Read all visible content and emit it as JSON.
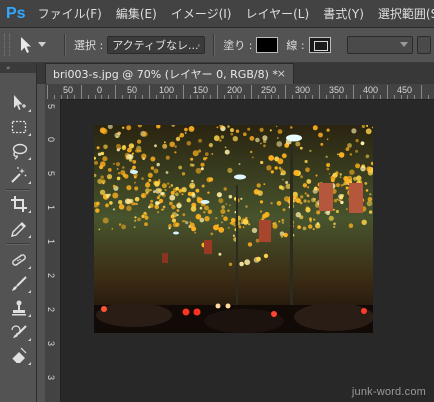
{
  "app": {
    "logo": "Ps"
  },
  "menu": [
    {
      "label": "ファイル(F)"
    },
    {
      "label": "編集(E)"
    },
    {
      "label": "イメージ(I)"
    },
    {
      "label": "レイヤー(L)"
    },
    {
      "label": "書式(Y)"
    },
    {
      "label": "選択範囲(S)"
    }
  ],
  "options": {
    "select_label": "選択 :",
    "select_value": "アクティブなレ...",
    "fill_label": "塗り :",
    "stroke_label": "線 :",
    "fill_color": "#000000"
  },
  "document": {
    "tab_title": "bri003-s.jpg @ 70% (レイヤー 0, RGB/8) *",
    "close_glyph": "×"
  },
  "ruler": {
    "top_labels": [
      "50",
      "0",
      "50",
      "100",
      "150",
      "200",
      "250",
      "300",
      "350",
      "400",
      "450"
    ],
    "left_labels": [
      "5",
      "0",
      "5",
      "1",
      "1",
      "2",
      "2",
      "3",
      "3"
    ]
  },
  "tools": [
    {
      "name": "path-selection-tool-icon"
    },
    {
      "name": "rectangular-marquee-tool-icon"
    },
    {
      "name": "lasso-tool-icon"
    },
    {
      "name": "magic-wand-tool-icon"
    },
    {
      "name": "crop-tool-icon"
    },
    {
      "name": "eyedropper-tool-icon"
    },
    {
      "name": "healing-brush-tool-icon"
    },
    {
      "name": "brush-tool-icon"
    },
    {
      "name": "clone-stamp-tool-icon"
    },
    {
      "name": "history-brush-tool-icon"
    },
    {
      "name": "eraser-tool-icon"
    }
  ],
  "watermark": "junk-word.com"
}
